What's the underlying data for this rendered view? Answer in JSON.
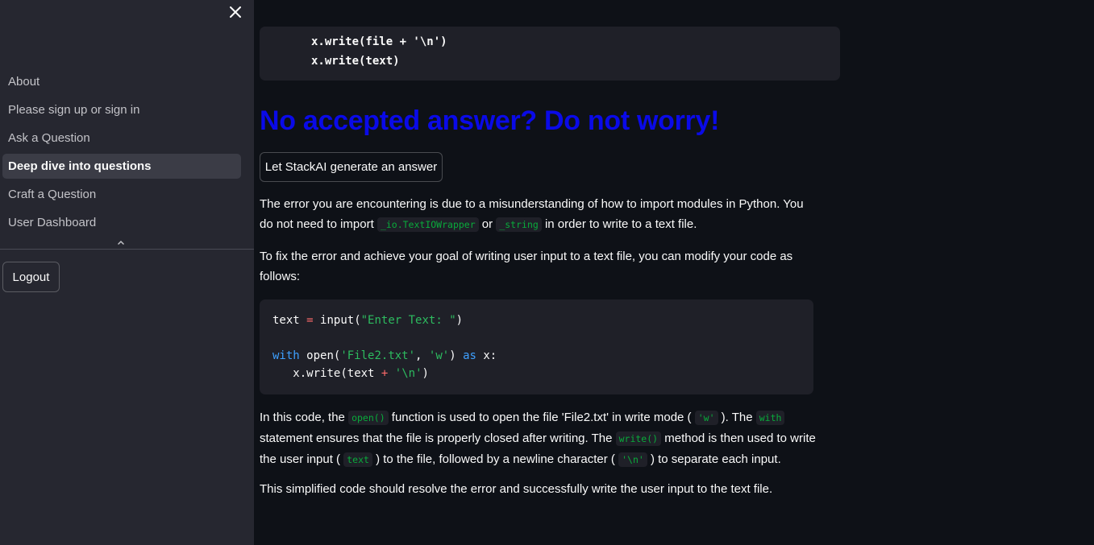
{
  "sidebar": {
    "items": [
      {
        "label": "About",
        "active": false
      },
      {
        "label": "Please sign up or sign in",
        "active": false
      },
      {
        "label": "Ask a Question",
        "active": false
      },
      {
        "label": "Deep dive into questions",
        "active": true
      },
      {
        "label": "Craft a Question",
        "active": false
      },
      {
        "label": "User Dashboard",
        "active": false
      }
    ],
    "logout_label": "Logout",
    "close_icon": "close-icon",
    "collapse_icon": "chevron-up-icon"
  },
  "main": {
    "top_code": {
      "line1": "x.write(file + '\\n')",
      "line2": "x.write(text)"
    },
    "heading": "No accepted answer? Do not worry!",
    "generate_button_label": "Let StackAI generate an answer",
    "p1": {
      "t1": "The error you are encountering is due to a misunderstanding of how to import modules in Python. You do not need to import ",
      "c1": "_io.TextIOWrapper",
      "t2": " or ",
      "c2": "_string",
      "t3": " in order to write to a text file."
    },
    "p2": "To fix the error and achieve your goal of writing user input to a text file, you can modify your code as follows:",
    "code": {
      "l1_var": "text",
      "l1_eq": "=",
      "l1_fn": "input",
      "l1_open": "(",
      "l1_str": "\"Enter Text: \"",
      "l1_close": ")",
      "l2_with": "with",
      "l2_fn": "open",
      "l2_open": "(",
      "l2_s1": "'File2.txt'",
      "l2_comma": ", ",
      "l2_s2": "'w'",
      "l2_close": ")",
      "l2_as": "as",
      "l2_x": "x:",
      "l3_obj": "x",
      "l3_dot": ".",
      "l3_fn": "write",
      "l3_open": "(",
      "l3_text": "text",
      "l3_plus": "+",
      "l3_str": "'\\n'",
      "l3_close": ")"
    },
    "p3": {
      "t1": "In this code, the ",
      "c1": "open()",
      "t2": " function is used to open the file 'File2.txt' in write mode ( ",
      "c2": "'w'",
      "t3": " ). The ",
      "c3": "with",
      "t4": " statement ensures that the file is properly closed after writing. The ",
      "c4": "write()",
      "t5": " method is then used to write the user input ( ",
      "c5": "text",
      "t6": " ) to the file, followed by a newline character ( ",
      "c6": "'\\n'",
      "t7": " ) to separate each input."
    },
    "p4": "This simplified code should resolve the error and successfully write the user input to the text file.",
    "colors": {
      "heading": "#0a0ae8",
      "code_string": "#09ab3b",
      "code_keyword": "#3ea0ff"
    }
  }
}
